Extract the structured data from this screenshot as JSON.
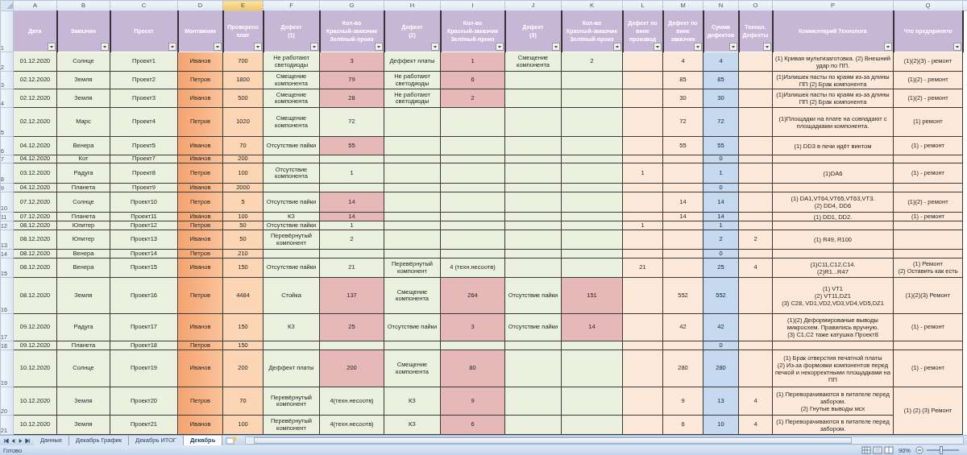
{
  "columns": [
    {
      "letter": "A",
      "selected": false
    },
    {
      "letter": "B",
      "selected": false
    },
    {
      "letter": "C",
      "selected": false
    },
    {
      "letter": "D",
      "selected": false
    },
    {
      "letter": "E",
      "selected": true
    },
    {
      "letter": "F",
      "selected": false
    },
    {
      "letter": "G",
      "selected": false
    },
    {
      "letter": "H",
      "selected": false
    },
    {
      "letter": "I",
      "selected": false
    },
    {
      "letter": "J",
      "selected": false
    },
    {
      "letter": "K",
      "selected": false
    },
    {
      "letter": "L",
      "selected": false
    },
    {
      "letter": "M",
      "selected": false
    },
    {
      "letter": "N",
      "selected": false
    },
    {
      "letter": "O",
      "selected": false
    },
    {
      "letter": "P",
      "selected": false
    },
    {
      "letter": "Q",
      "selected": false
    }
  ],
  "header_row_number": "1",
  "header": [
    "Дата",
    "Заказчик",
    "Проект",
    "Монтажник",
    "Проверено\nплат",
    "Дефект\n(1)",
    "Кол-во\nКрасный-заказчик\nЗелёный-произ",
    "Дефект\n(2)",
    "Кол-во\nКрасный-заказчик\nЗелёный-произ",
    "Дефект\n(3)",
    "Кол-во\nКрасный-заказчик\nЗелёный-произ",
    "Дефект по\nвине\nпроизвод",
    "Дефект по\nвине\nзаказчик",
    "Сумма\nдефектов",
    "Технол.\nДефекты",
    "Комментарий Технолога",
    "Что предпринято"
  ],
  "rows": [
    {
      "number": "2",
      "a": "01.12.2020",
      "b": "Солнце",
      "c": "Проект1",
      "d": "Иванов",
      "e": "700",
      "f": "Не работают светодиоды",
      "g": {
        "text": "3",
        "highlighted": true
      },
      "h": "Деффект платы",
      "i": {
        "text": "1",
        "highlighted": true
      },
      "j": "Смещение компонента",
      "k": {
        "text": "2",
        "highlighted": false
      },
      "m": "4",
      "n": "4",
      "p": "(1) Кривая мультизаготовка. (2) Внешний удар по ПП.",
      "q": "(1)(2)(3) - ремонт"
    },
    {
      "number": "3",
      "a": "02.12.2020",
      "b": "Земля",
      "c": "Проект2",
      "d": "Петров",
      "e": "1800",
      "f": "Смещение компонента",
      "g": {
        "text": "79",
        "highlighted": true
      },
      "h": "Не работают светодиоды",
      "i": {
        "text": "6",
        "highlighted": true
      },
      "m": "85",
      "n": "85",
      "p": "(1)Излишек пасты по краям из-за длины ПП (2) Брак компонента",
      "q": "(1)(2) - ремонт"
    },
    {
      "number": "4",
      "a": "02.12.2020",
      "b": "Земля",
      "c": "Проект3",
      "d": "Иванов",
      "e": "500",
      "f": "Смещение компонента",
      "g": {
        "text": "28",
        "highlighted": true
      },
      "h": "Не работают светодиоды",
      "i": {
        "text": "2",
        "highlighted": true
      },
      "m": "30",
      "n": "30",
      "p": "(1)Излишек пасты по краям из-за длины ПП (2) Брак компонента",
      "q": "(1)(2) - ремонт"
    },
    {
      "number": "5",
      "a": "02.12.2020",
      "b": "Марс",
      "c": "Проект4",
      "d": "Петров",
      "e": "1020",
      "f": "Смещение компонента",
      "g": {
        "text": "72",
        "highlighted": false
      },
      "m": "72",
      "n": "72",
      "p": "(1)Площадки на плате на совпадают с площадками компонента.",
      "q": "(1) ремонт"
    },
    {
      "number": "6",
      "a": "04.12.2020",
      "b": "Венера",
      "c": "Проект5",
      "d": "Иванов",
      "e": "70",
      "f": "Отсутствие пайки",
      "g": {
        "text": "55",
        "highlighted": true
      },
      "m": "55",
      "n": "55",
      "p": "(1) DD3 в печи идёт винтом",
      "q": "(1) - ремонт"
    },
    {
      "number": "7",
      "a": "04.12.2020",
      "b": "Кот",
      "c": "Проект7",
      "d": "Иванов",
      "e": "200",
      "n": "0"
    },
    {
      "number": "8",
      "a": "03.12.2020",
      "b": "Радуга",
      "c": "Проект8",
      "d": "Петров",
      "e": "100",
      "f": "Отсутствие компонента",
      "g": {
        "text": "1",
        "highlighted": false
      },
      "l": "1",
      "n": "1",
      "p": "(1)DA6",
      "q": "(1) - ремонт"
    },
    {
      "number": "9",
      "a": "04.12.2020",
      "b": "Планета",
      "c": "Проект9",
      "d": "Иванов",
      "e": "2000",
      "n": "0"
    },
    {
      "number": "10",
      "a": "07.12.2020",
      "b": "Солнце",
      "c": "Проект10",
      "d": "Петров",
      "e": "5",
      "f": "Отсутствие пайки",
      "g": {
        "text": "14",
        "highlighted": true
      },
      "m": "14",
      "n": "14",
      "p": "(1) DA1,VT64,VT65,VT63,VT3.\n(2) DD4, DD6",
      "q": "(1)(2) - ремонт"
    },
    {
      "number": "11",
      "a": "07.12.2020",
      "b": "Планета",
      "c": "Проект11",
      "d": "Иванов",
      "e": "100",
      "f": "КЗ",
      "g": {
        "text": "14",
        "highlighted": true
      },
      "m": "14",
      "n": "14",
      "p": "(1) DD1, DD2.",
      "q": "(1) - ремонт"
    },
    {
      "number": "12",
      "a": "08.12.2020",
      "b": "Юпитер",
      "c": "Проект12",
      "d": "Петров",
      "e": "50",
      "f": "Отсутствие пайки",
      "g": {
        "text": "1",
        "highlighted": false
      },
      "l": "1",
      "n": "1"
    },
    {
      "number": "13",
      "a": "08.12.2020",
      "b": "Юпитер",
      "c": "Проект13",
      "d": "Иванов",
      "e": "50",
      "f": "Перевёрнутый компонент",
      "g": {
        "text": "2",
        "highlighted": false
      },
      "n": "2",
      "o": "2",
      "p": "(1) R49, R100"
    },
    {
      "number": "14",
      "a": "08.12.2020",
      "b": "Венера",
      "c": "Проект14",
      "d": "Петров",
      "e": "210",
      "n": "0"
    },
    {
      "number": "15",
      "a": "08.12.2020",
      "b": "Венера",
      "c": "Проект15",
      "d": "Иванов",
      "e": "150",
      "f": "Отсутствие пайки",
      "g": {
        "text": "21",
        "highlighted": false
      },
      "h": "Перевёрнутый компонент",
      "i": {
        "text": "4 (техн.несоотв)",
        "highlighted": false
      },
      "l": "21",
      "n": "25",
      "o": "4",
      "p": "(1)C11,C12,C14.\n(2)R1...R47",
      "q": "(1) Ремонт\n(2) Оставить как есть"
    },
    {
      "number": "16",
      "a": "08.12.2020",
      "b": "Земля",
      "c": "Проект16",
      "d": "Петров",
      "e": "4484",
      "f": "Стойка",
      "g": {
        "text": "137",
        "highlighted": true
      },
      "h": "Смещение компонента",
      "i": {
        "text": "264",
        "highlighted": true
      },
      "j": "Отсутствие пайки",
      "k": {
        "text": "151",
        "highlighted": true
      },
      "m": "552",
      "n": "552",
      "p": "(1) VT1\n(2) VT11,DZ1\n(3) C28, VD1,VD2,VD3,VD4,VD5,DZ1",
      "q": "(1)(2)(3) Ремонт"
    },
    {
      "number": "17",
      "a": "09.12.2020",
      "b": "Радуга",
      "c": "Проект17",
      "d": "Иванов",
      "e": "150",
      "f": "КЗ",
      "g": {
        "text": "25",
        "highlighted": true
      },
      "h": "Отсутствие пайки",
      "i": {
        "text": "3",
        "highlighted": true
      },
      "j": "Отсутствие пайки",
      "k": {
        "text": "14",
        "highlighted": true
      },
      "m": "42",
      "n": "42",
      "p": "(1)(2) Деформированые выводы микросхем. Правились вручную.\n(3) C1,C2 таже катушка Проект8",
      "q": "(1) - ремонт"
    },
    {
      "number": "18",
      "a": "09.12.2020",
      "b": "Планета",
      "c": "Проект18",
      "d": "Петров",
      "e": "150",
      "n": "0"
    },
    {
      "number": "19",
      "a": "10.12.2020",
      "b": "Солнце",
      "c": "Проект19",
      "d": "Иванов",
      "e": "200",
      "f": "Деффект платы",
      "g": {
        "text": "200",
        "highlighted": true
      },
      "h": "Смещение компонента",
      "i": {
        "text": "80",
        "highlighted": true
      },
      "m": "280",
      "n": "280",
      "p": "(1) Брак отверстия печатной платы\n(2) Из-за формовки компонентов перед печкой и некорректными площадками на ПП",
      "q": "(1) - ремонт"
    },
    {
      "number": "20",
      "a": "10.12.2020",
      "b": "Земля",
      "c": "Проект20",
      "d": "Петров",
      "e": "70",
      "f": "Перевёрнутый компонент",
      "g": {
        "text": "4(техн.несоотв)",
        "highlighted": false
      },
      "h": "КЗ",
      "i": {
        "text": "9",
        "highlighted": true
      },
      "m": "9",
      "n": "13",
      "o": "4",
      "p": "(1) Переворачиваются в питателе перед забором.\n(2) Гнутые выводы мсх",
      "q": "(1) (2) (3) Ремонт",
      "q_merged_down": true
    },
    {
      "number": "21",
      "a": "10.12.2020",
      "b": "Земля",
      "c": "Проект21",
      "d": "Иванов",
      "e": "100",
      "f": "Перевёрнутый компонент",
      "g": {
        "text": "4(техн.несоотв)",
        "highlighted": false
      },
      "h": "КЗ",
      "i": {
        "text": "6",
        "highlighted": true
      },
      "m": "6",
      "n": "10",
      "o": "4",
      "p": "(1) Переворачиваются в питателе перед забором."
    }
  ],
  "sheet_tabs": [
    {
      "label": "Данные",
      "selected": false
    },
    {
      "label": "Декабрь График",
      "selected": false
    },
    {
      "label": "Декабрь ИТОГ",
      "selected": false
    },
    {
      "label": "Декабрь",
      "selected": true
    }
  ],
  "status": {
    "text": "Готово",
    "zoom": "90%",
    "zoom_slider": {
      "level": 0.45
    }
  }
}
